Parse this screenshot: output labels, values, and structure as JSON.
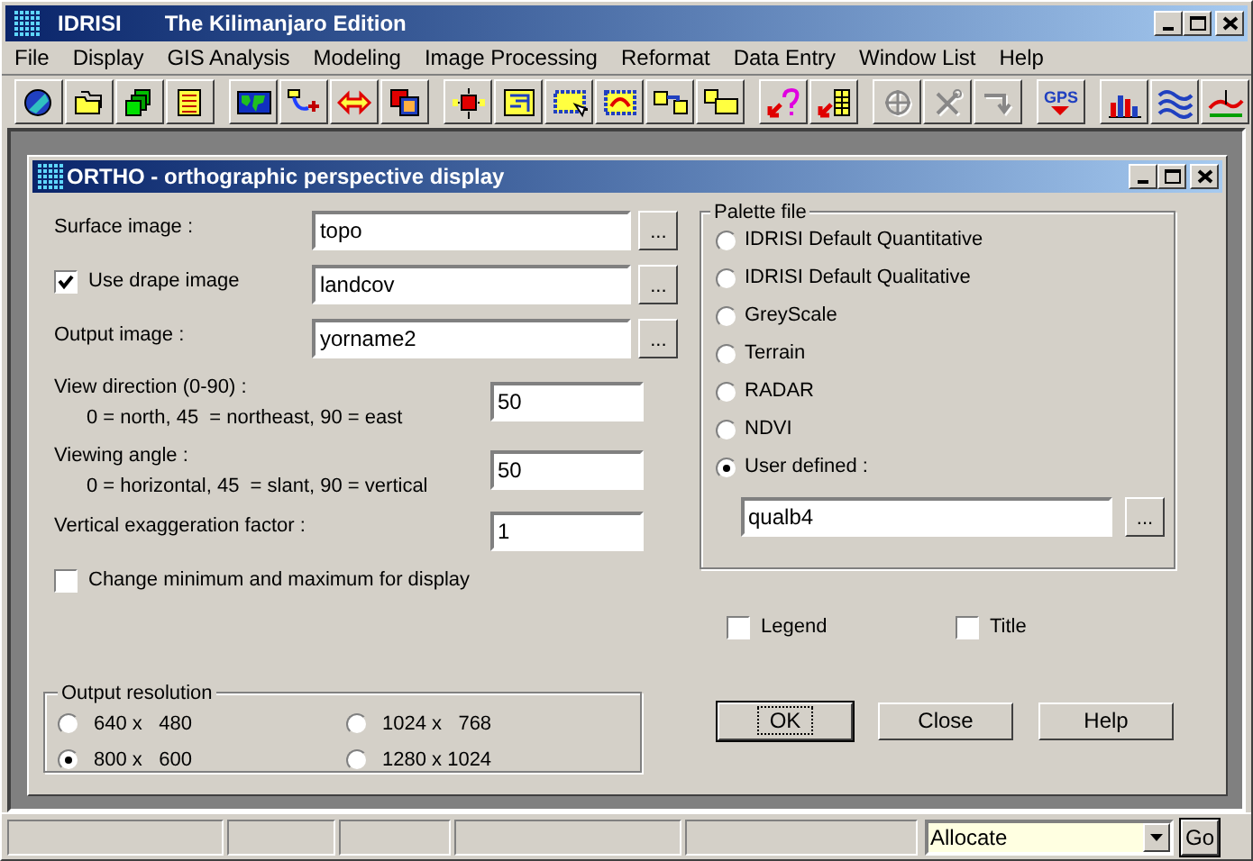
{
  "app": {
    "title": "IDRISI",
    "subtitle": "The Kilimanjaro Edition"
  },
  "menu": [
    "File",
    "Display",
    "GIS Analysis",
    "Modeling",
    "Image Processing",
    "Reformat",
    "Data Entry",
    "Window List",
    "Help"
  ],
  "toolbar": [
    {
      "kind": "globe",
      "disabled": false,
      "group_start": false
    },
    {
      "kind": "folder",
      "disabled": false,
      "group_start": false
    },
    {
      "kind": "layers",
      "disabled": false,
      "group_start": false
    },
    {
      "kind": "list",
      "disabled": false,
      "group_start": false
    },
    {
      "kind": "map",
      "disabled": false,
      "group_start": true
    },
    {
      "kind": "path",
      "disabled": false,
      "group_start": false
    },
    {
      "kind": "arrows",
      "disabled": false,
      "group_start": false
    },
    {
      "kind": "squares",
      "disabled": false,
      "group_start": false
    },
    {
      "kind": "network",
      "disabled": false,
      "group_start": true
    },
    {
      "kind": "frame",
      "disabled": false,
      "group_start": false
    },
    {
      "kind": "select",
      "disabled": false,
      "group_start": false
    },
    {
      "kind": "region",
      "disabled": false,
      "group_start": false
    },
    {
      "kind": "link",
      "disabled": false,
      "group_start": false
    },
    {
      "kind": "boxes",
      "disabled": false,
      "group_start": false
    },
    {
      "kind": "query",
      "disabled": false,
      "group_start": true
    },
    {
      "kind": "table",
      "disabled": false,
      "group_start": false
    },
    {
      "kind": "crosshair",
      "disabled": true,
      "group_start": true
    },
    {
      "kind": "tools",
      "disabled": true,
      "group_start": false
    },
    {
      "kind": "turn",
      "disabled": true,
      "group_start": false
    },
    {
      "kind": "gps",
      "label": "GPS",
      "disabled": false,
      "group_start": true
    },
    {
      "kind": "histogram",
      "disabled": false,
      "group_start": true
    },
    {
      "kind": "waves",
      "disabled": false,
      "group_start": false
    },
    {
      "kind": "profile",
      "disabled": false,
      "group_start": false
    }
  ],
  "dialog": {
    "title": "ORTHO - orthographic perspective display",
    "fields": [
      {
        "kind": "file",
        "label": "Surface image :",
        "value": "topo",
        "browse": "..."
      },
      {
        "kind": "file-check",
        "label": "Use drape image",
        "checked": true,
        "value": "landcov",
        "browse": "..."
      },
      {
        "kind": "file",
        "label": "Output image :",
        "value": "yorname2",
        "browse": "..."
      },
      {
        "kind": "number",
        "label": "View direction (0-90) :",
        "hint": "0 = north, 45  = northeast, 90 = east",
        "value": "50"
      },
      {
        "kind": "number",
        "label": "Viewing angle :",
        "hint": "0 = horizontal, 45  = slant, 90 = vertical",
        "value": "50"
      },
      {
        "kind": "number",
        "label": "Vertical exaggeration factor :",
        "value": "1"
      }
    ],
    "minmax": {
      "label": "Change minimum and maximum for display",
      "checked": false
    },
    "resolution": {
      "title": "Output resolution",
      "options": [
        {
          "label": "640 x   480",
          "selected": false
        },
        {
          "label": "1024 x   768",
          "selected": false
        },
        {
          "label": "800 x   600",
          "selected": true
        },
        {
          "label": "1280 x 1024",
          "selected": false
        }
      ]
    },
    "palette": {
      "title": "Palette file",
      "options": [
        {
          "label": "IDRISI Default Quantitative",
          "selected": false
        },
        {
          "label": "IDRISI Default Qualitative",
          "selected": false
        },
        {
          "label": "GreyScale",
          "selected": false
        },
        {
          "label": "Terrain",
          "selected": false
        },
        {
          "label": "RADAR",
          "selected": false
        },
        {
          "label": "NDVI",
          "selected": false
        },
        {
          "label": "User defined :",
          "selected": true
        }
      ],
      "value": "qualb4",
      "browse": "..."
    },
    "options": [
      {
        "label": "Legend",
        "checked": false
      },
      {
        "label": "Title",
        "checked": false
      }
    ],
    "buttons": [
      {
        "label": "OK",
        "default": true
      },
      {
        "label": "Close",
        "default": false
      },
      {
        "label": "Help",
        "default": false
      }
    ]
  },
  "status_bar": {
    "command": "Allocate",
    "go": "Go"
  }
}
